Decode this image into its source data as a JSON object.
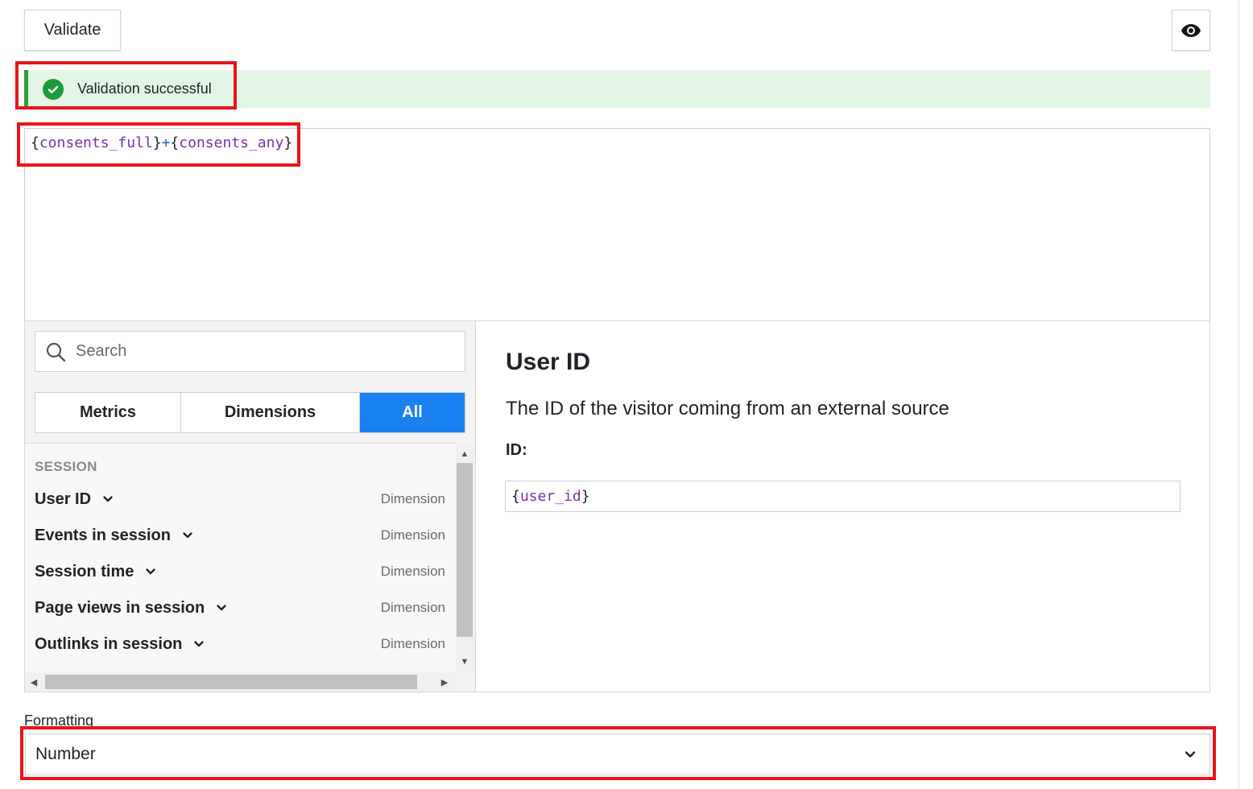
{
  "toolbar": {
    "validate_label": "Validate",
    "preview_icon": "eye-icon"
  },
  "alert": {
    "message": "Validation successful",
    "icon": "check-circle-icon",
    "color": "#2e9f3a"
  },
  "editor": {
    "segments": [
      {
        "text": "{",
        "kind": "brace"
      },
      {
        "text": "consents_full",
        "kind": "var"
      },
      {
        "text": "}",
        "kind": "brace"
      },
      {
        "text": "+",
        "kind": "op"
      },
      {
        "text": "{",
        "kind": "brace"
      },
      {
        "text": "consents_any",
        "kind": "var"
      },
      {
        "text": "}",
        "kind": "brace"
      }
    ]
  },
  "picker": {
    "search_placeholder": "Search",
    "tabs": [
      {
        "label": "Metrics",
        "active": false
      },
      {
        "label": "Dimensions",
        "active": false
      },
      {
        "label": "All",
        "active": true
      }
    ],
    "category": "SESSION",
    "items": [
      {
        "name": "User ID",
        "type": "Dimension"
      },
      {
        "name": "Events in session",
        "type": "Dimension"
      },
      {
        "name": "Session time",
        "type": "Dimension"
      },
      {
        "name": "Page views in session",
        "type": "Dimension"
      },
      {
        "name": "Outlinks in session",
        "type": "Dimension"
      }
    ]
  },
  "detail": {
    "title": "User ID",
    "description": "The ID of the visitor coming from an external source",
    "id_label": "ID:",
    "id_open": "{",
    "id_value": "user_id",
    "id_close": "}"
  },
  "formatting": {
    "label": "Formatting",
    "selected": "Number"
  },
  "colors": {
    "accent": "#1a82f0",
    "success": "#2e9f3a",
    "highlight": "#e8141c",
    "variable": "#7a2fb5"
  }
}
